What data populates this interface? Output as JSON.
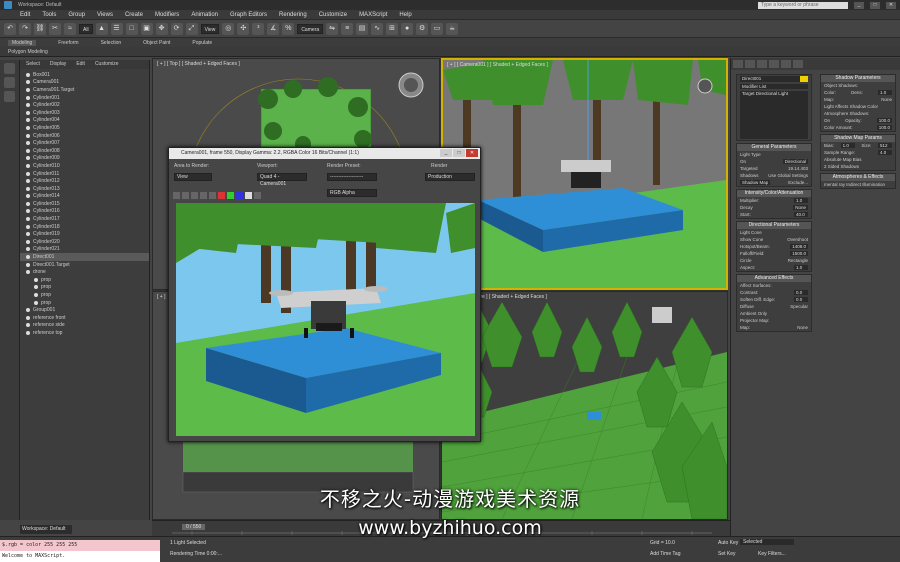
{
  "titlebar": {
    "workspace": "Workspace: Default",
    "search_placeholder": "Type a keyword or phrase",
    "controls": [
      "_",
      "□",
      "✕"
    ]
  },
  "menubar": [
    "Edit",
    "Tools",
    "Group",
    "Views",
    "Create",
    "Modifiers",
    "Animation",
    "Graph Editors",
    "Rendering",
    "Customize",
    "MAXScript",
    "Help"
  ],
  "toolbar": {
    "selection_filter": "All",
    "view_dropdown": "View",
    "camera_dropdown": "Camera"
  },
  "ribbon": {
    "tabs": [
      "Modeling",
      "Freeform",
      "Selection",
      "Object Paint",
      "Populate"
    ],
    "active_tab": "Modeling",
    "subtitle": "Polygon Modeling"
  },
  "scene_explorer": {
    "menu": [
      "Select",
      "Display",
      "Edit",
      "Customize"
    ],
    "items": [
      {
        "label": "Box001"
      },
      {
        "label": "Camera001"
      },
      {
        "label": "Camera001.Target"
      },
      {
        "label": "Cylinder001"
      },
      {
        "label": "Cylinder002"
      },
      {
        "label": "Cylinder003"
      },
      {
        "label": "Cylinder004"
      },
      {
        "label": "Cylinder005"
      },
      {
        "label": "Cylinder006"
      },
      {
        "label": "Cylinder007"
      },
      {
        "label": "Cylinder008"
      },
      {
        "label": "Cylinder009"
      },
      {
        "label": "Cylinder010"
      },
      {
        "label": "Cylinder011"
      },
      {
        "label": "Cylinder012"
      },
      {
        "label": "Cylinder013"
      },
      {
        "label": "Cylinder014"
      },
      {
        "label": "Cylinder015"
      },
      {
        "label": "Cylinder016"
      },
      {
        "label": "Cylinder017"
      },
      {
        "label": "Cylinder018"
      },
      {
        "label": "Cylinder019"
      },
      {
        "label": "Cylinder020"
      },
      {
        "label": "Cylinder021"
      },
      {
        "label": "Direct001",
        "selected": true
      },
      {
        "label": "Direct001.Target"
      },
      {
        "label": "drone"
      },
      {
        "label": "prop",
        "indent": true
      },
      {
        "label": "prop",
        "indent": true
      },
      {
        "label": "prop",
        "indent": true
      },
      {
        "label": "prop",
        "indent": true
      },
      {
        "label": "Group001"
      },
      {
        "label": "reference front"
      },
      {
        "label": "reference side"
      },
      {
        "label": "reference top"
      }
    ]
  },
  "viewports": {
    "top_label": "[ + ] [ Top ] [ Shaded + Edged Faces ]",
    "camera_label": "[ + ] [ Camera001 ] [ Shaded + Edged Faces ]",
    "left_label": "[ + ]",
    "persp_label": "[ + ] [ Perspective ] [ Shaded + Edged Faces ]"
  },
  "render_dialog": {
    "title": "Camera001, frame 550, Display Gamma: 2.2, RGBA Color 16 Bits/Channel (1:1)",
    "area_label": "Area to Render:",
    "area_value": "View",
    "viewport_label": "Viewport:",
    "viewport_value": "Quad 4 - Camera001",
    "preset_label": "Render Preset:",
    "preset_value": "--------------------",
    "render_label": "Render",
    "render_value": "Production",
    "channel_value": "RGB Alpha"
  },
  "command_panel": {
    "object_name": "Direct001",
    "modifier_list": "Modifier List",
    "stack_item": "Target Directional Light",
    "general": {
      "title": "General Parameters",
      "light_type": "Light Type",
      "on": "On",
      "type": "Directional",
      "targeted": "Targeted",
      "target_dist": "19.14.403",
      "shadows": "Shadows",
      "use_global": "Use Global Settings",
      "shadow_type": "Shadow Map",
      "exclude": "Exclude..."
    },
    "intensity": {
      "title": "Intensity/Color/Attenuation",
      "multiplier_label": "Multiplier:",
      "multiplier": "1.0",
      "decay": "Decay",
      "decay_type": "None",
      "start": "40.0"
    },
    "directional": {
      "title": "Directional Parameters",
      "light_cone": "Light Cone",
      "show_cone": "Show Cone",
      "overshoot": "Overshoot",
      "hotspot_label": "Hotspot/Beam:",
      "hotspot": "1408.0",
      "falloff_label": "Falloff/Field:",
      "falloff": "1500.0",
      "circle": "Circle",
      "rectangle": "Rectangle",
      "aspect_label": "Aspect:",
      "aspect": "1.0"
    },
    "advanced": {
      "title": "Advanced Effects",
      "affect_surfaces": "Affect Surfaces:",
      "contrast_label": "Contrast:",
      "contrast": "0.0",
      "soften_label": "Soften Diff. Edge:",
      "soften": "0.0",
      "diffuse": "Diffuse",
      "specular": "Specular",
      "ambient": "Ambient Only",
      "projector": "Projector Map:",
      "map": "Map:",
      "none": "None"
    },
    "shadow_params": {
      "title": "Shadow Parameters",
      "object_shadows": "Object Shadows:",
      "color_label": "Color:",
      "dens_label": "Dens:",
      "dens": "1.0",
      "map": "Map:",
      "none": "None",
      "affects_color": "Light Affects Shadow Color",
      "atmo": "Atmosphere Shadows:",
      "on": "On",
      "opacity_label": "Opacity:",
      "opacity": "100.0",
      "color_amount_label": "Color Amount:",
      "color_amount": "100.0"
    },
    "shadow_map": {
      "title": "Shadow Map Params",
      "bias_label": "Bias:",
      "bias": "1.0",
      "size_label": "Size:",
      "size": "512",
      "sample_label": "Sample Range:",
      "sample": "4.0",
      "absolute": "Absolute Map Bias",
      "two_sided": "2 Sided Shadows"
    },
    "atmos": {
      "title": "Atmospheres & Effects",
      "item": "mental ray Indirect Illumination"
    }
  },
  "timeline": {
    "frame": "0 / 550"
  },
  "status": {
    "selected": "1 Light Selected",
    "rendering_time": "Rendering Time 0:00:...",
    "grid": "Grid = 10.0",
    "add_time_tag": "Add Time Tag",
    "auto_key": "Auto Key",
    "auto_key_value": "Selected",
    "set_key": "Set Key",
    "key_filters": "Key Filters...",
    "workspace": "Workspace: Default"
  },
  "maxscript": {
    "line1": "$.rgb = color 255 255 255",
    "line2": "Welcome to MAXScript."
  },
  "watermark": {
    "line1": "不移之火-动漫游戏美术资源",
    "line2": "www.byzhihuo.com"
  },
  "colors": {
    "accent_yellow": "#d4b000",
    "grass": "#5dbb4a",
    "sky": "#7cc7ee",
    "platform_blue": "#2f8fd6",
    "tree_green": "#3f8f2c"
  }
}
